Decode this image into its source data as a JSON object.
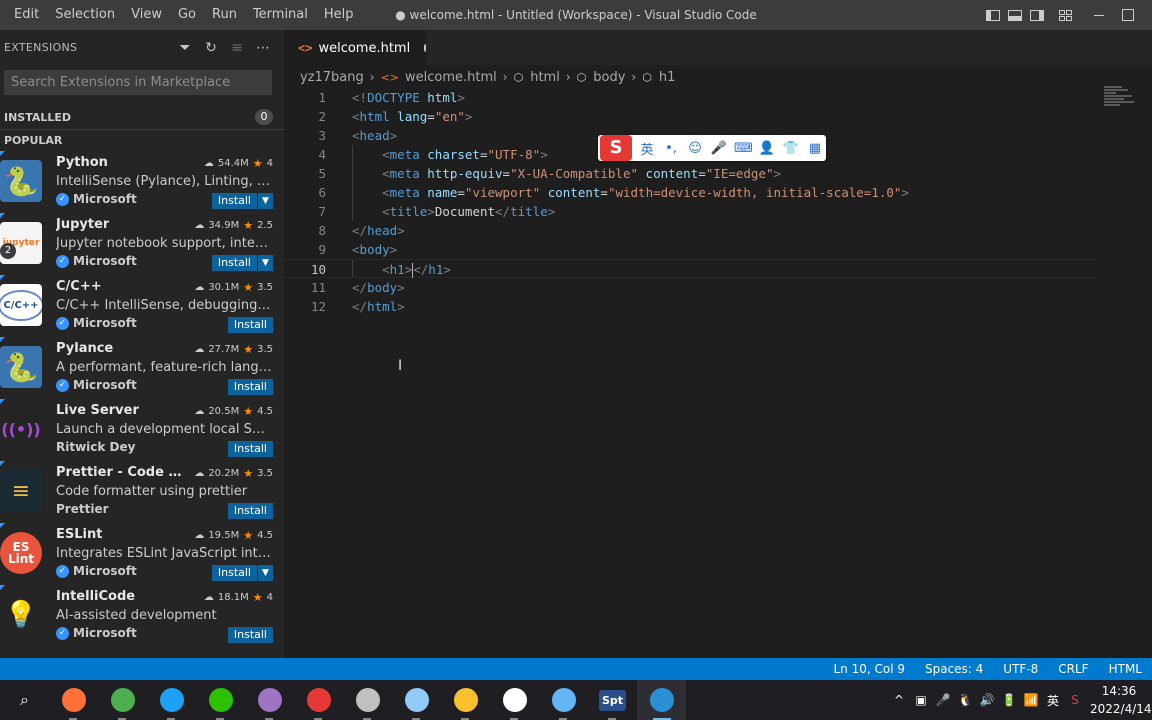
{
  "titlebar": {
    "menu": [
      "Edit",
      "Selection",
      "View",
      "Go",
      "Run",
      "Terminal",
      "Help"
    ],
    "title": "● welcome.html - Untitled (Workspace) - Visual Studio Code"
  },
  "sidebar": {
    "title": "EXTENSIONS",
    "search_placeholder": "Search Extensions in Marketplace",
    "installed_label": "INSTALLED",
    "installed_count": "0",
    "popular_label": "POPULAR",
    "extensions": [
      {
        "name": "Python",
        "downloads": "54.4M",
        "rating": "4",
        "description": "IntelliSense (Pylance), Linting, Debu...",
        "publisher": "Microsoft",
        "verified": true,
        "install": "Install",
        "dropdown": true,
        "icon_color": "#3a75b0",
        "icon_glyph": "🐍"
      },
      {
        "name": "Jupyter",
        "downloads": "34.9M",
        "rating": "2.5",
        "description": "Jupyter notebook support, interacti...",
        "publisher": "Microsoft",
        "verified": true,
        "install": "Install",
        "dropdown": true,
        "icon_color": "#f5f5f5",
        "icon_glyph": "jupyter",
        "badge": "2"
      },
      {
        "name": "C/C++",
        "downloads": "30.1M",
        "rating": "3.5",
        "description": "C/C++ IntelliSense, debugging, and...",
        "publisher": "Microsoft",
        "verified": true,
        "install": "Install",
        "dropdown": false,
        "icon_color": "#ffffff",
        "icon_glyph": "C/C++"
      },
      {
        "name": "Pylance",
        "downloads": "27.7M",
        "rating": "3.5",
        "description": "A performant, feature-rich language...",
        "publisher": "Microsoft",
        "verified": true,
        "install": "Install",
        "dropdown": false,
        "icon_color": "#3a75b0",
        "icon_glyph": "🐍"
      },
      {
        "name": "Live Server",
        "downloads": "20.5M",
        "rating": "4.5",
        "description": "Launch a development local Server ...",
        "publisher": "Ritwick Dey",
        "verified": false,
        "install": "Install",
        "dropdown": false,
        "icon_color": "#252526",
        "icon_glyph": "((•))"
      },
      {
        "name": "Prettier - Code for...",
        "downloads": "20.2M",
        "rating": "3.5",
        "description": "Code formatter using prettier",
        "publisher": "Prettier",
        "verified": false,
        "install": "Install",
        "dropdown": false,
        "icon_color": "#1a2b34",
        "icon_glyph": "≡"
      },
      {
        "name": "ESLint",
        "downloads": "19.5M",
        "rating": "4.5",
        "description": "Integrates ESLint JavaScript into VS ...",
        "publisher": "Microsoft",
        "verified": true,
        "install": "Install",
        "dropdown": true,
        "icon_color": "#e8543c",
        "icon_glyph": "ES Lint"
      },
      {
        "name": "IntelliCode",
        "downloads": "18.1M",
        "rating": "4",
        "description": "AI-assisted development",
        "publisher": "Microsoft",
        "verified": true,
        "install": "Install",
        "dropdown": false,
        "icon_color": "#252526",
        "icon_glyph": "💡"
      }
    ]
  },
  "editor": {
    "tab_label": "welcome.html",
    "breadcrumb": [
      "yz17bang",
      "welcome.html",
      "html",
      "body",
      "h1"
    ],
    "lines": [
      {
        "n": "1",
        "html": "<span class='tg'>&lt;!</span><span class='tn'>DOCTYPE</span> <span class='an'>html</span><span class='tg'>&gt;</span>"
      },
      {
        "n": "2",
        "html": "<span class='tg'>&lt;</span><span class='tn'>html</span> <span class='an'>lang</span>=<span class='av'>\"en\"</span><span class='tg'>&gt;</span>"
      },
      {
        "n": "3",
        "html": "<span class='tg'>&lt;</span><span class='tn'>head</span><span class='tg'>&gt;</span>"
      },
      {
        "n": "4",
        "html": "    <span class='tg'>&lt;</span><span class='tn'>meta</span> <span class='an'>charset</span>=<span class='av'>\"UTF-8\"</span><span class='tg'>&gt;</span>"
      },
      {
        "n": "5",
        "html": "    <span class='tg'>&lt;</span><span class='tn'>meta</span> <span class='an'>http-equiv</span>=<span class='av'>\"X-UA-Compatible\"</span> <span class='an'>content</span>=<span class='av'>\"IE=edge\"</span><span class='tg'>&gt;</span>"
      },
      {
        "n": "6",
        "html": "    <span class='tg'>&lt;</span><span class='tn'>meta</span> <span class='an'>name</span>=<span class='av'>\"viewport\"</span> <span class='an'>content</span>=<span class='av'>\"width=device-width, initial-scale=1.0\"</span><span class='tg'>&gt;</span>"
      },
      {
        "n": "7",
        "html": "    <span class='tg'>&lt;</span><span class='tn'>title</span><span class='tg'>&gt;</span><span class='tx'>Document</span><span class='tg'>&lt;/</span><span class='tn'>title</span><span class='tg'>&gt;</span>"
      },
      {
        "n": "8",
        "html": "<span class='tg'>&lt;/</span><span class='tn'>head</span><span class='tg'>&gt;</span>"
      },
      {
        "n": "9",
        "html": "<span class='tg'>&lt;</span><span class='tn'>body</span><span class='tg'>&gt;</span>"
      },
      {
        "n": "10",
        "html": "    <span class='tg'>&lt;</span><span class='tn'>h1</span><span class='tg'>&gt;</span><span class='caret'></span><span class='tg'>&lt;/</span><span class='tn'>h1</span><span class='tg'>&gt;</span>",
        "current": true
      },
      {
        "n": "11",
        "html": "<span class='tg'>&lt;/</span><span class='tn'>body</span><span class='tg'>&gt;</span>"
      },
      {
        "n": "12",
        "html": "<span class='tg'>&lt;/</span><span class='tn'>html</span><span class='tg'>&gt;</span>"
      }
    ]
  },
  "ime": {
    "logo": "S",
    "buttons": [
      "英",
      "•,",
      "☺",
      "🎤",
      "⌨",
      "👤",
      "👕",
      "▦"
    ]
  },
  "statusbar": {
    "position": "Ln 10, Col 9",
    "spaces": "Spaces: 4",
    "encoding": "UTF-8",
    "eol": "CRLF",
    "language": "HTML"
  },
  "taskbar": {
    "apps": [
      {
        "name": "search-icon",
        "color": "#ffffff"
      },
      {
        "name": "firefox-icon",
        "color": "#ff7139"
      },
      {
        "name": "chrome-icon",
        "color": "#4caf50"
      },
      {
        "name": "edge-icon",
        "color": "#1da1f2"
      },
      {
        "name": "wechat-icon",
        "color": "#2dc100"
      },
      {
        "name": "visual-studio-icon",
        "color": "#a074c4"
      },
      {
        "name": "wps-icon",
        "color": "#e53935"
      },
      {
        "name": "paint-icon",
        "color": "#c0c0c0"
      },
      {
        "name": "notes-icon",
        "color": "#90caf9"
      },
      {
        "name": "file-explorer-icon",
        "color": "#fbc02d"
      },
      {
        "name": "bilibili-icon",
        "color": "#ffffff"
      },
      {
        "name": "snipping-icon",
        "color": "#64b5f6"
      },
      {
        "name": "spt-icon",
        "color": "#2b4f8a",
        "label": "Spt"
      },
      {
        "name": "vscode-icon",
        "color": "#2b8fd6",
        "active": true
      }
    ],
    "tray": [
      "^",
      "▣",
      "🎤",
      "🐧",
      "🔊",
      "🔋",
      "📶",
      "英",
      "S"
    ],
    "time": "14:36",
    "date": "2022/4/14"
  }
}
